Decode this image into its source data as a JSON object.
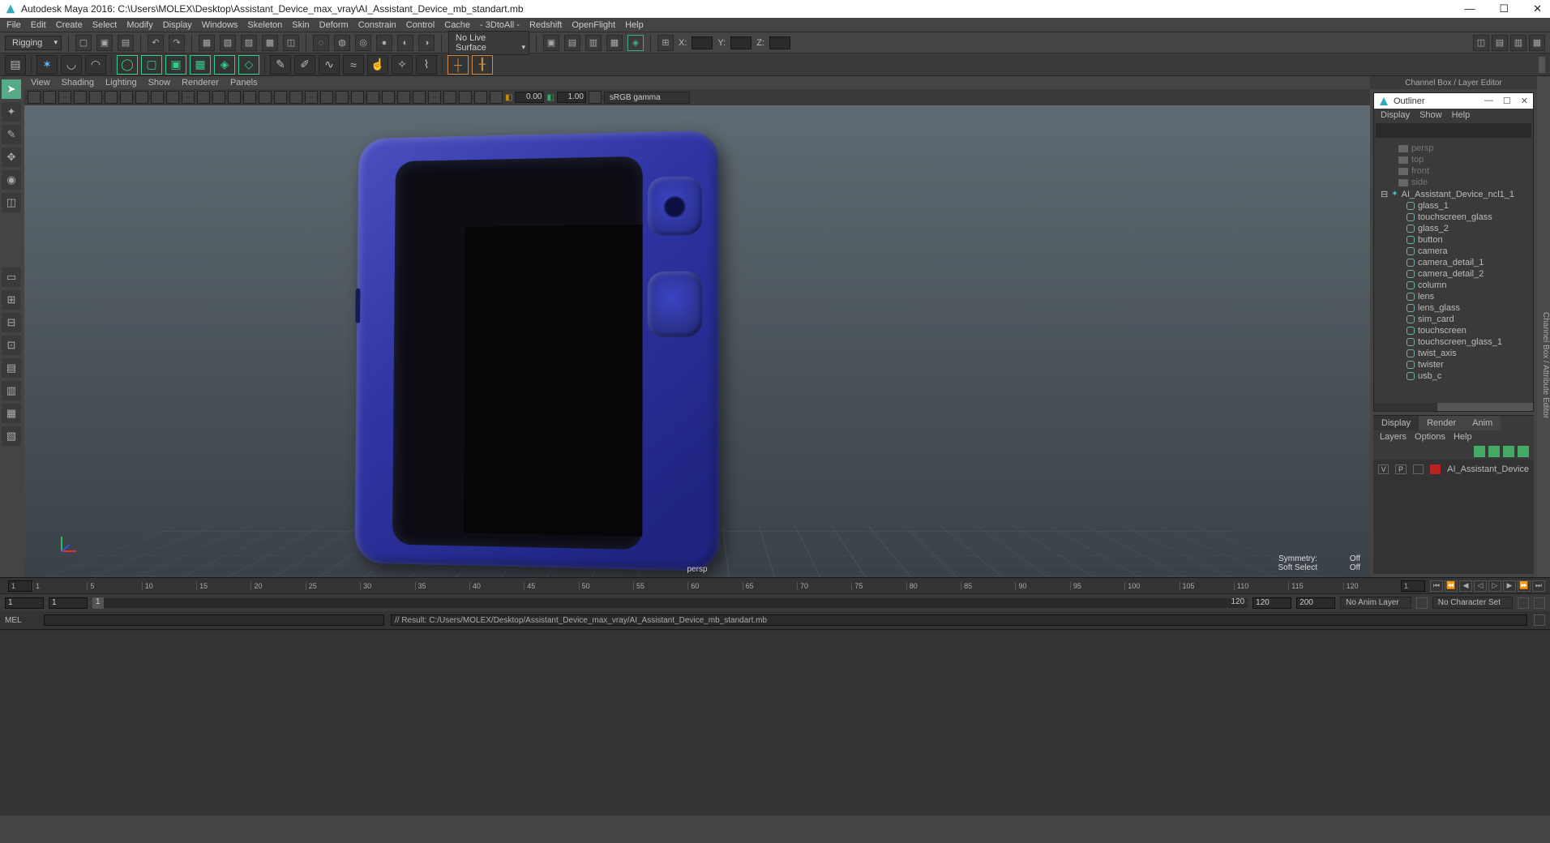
{
  "title": "Autodesk Maya 2016: C:\\Users\\MOLEX\\Desktop\\Assistant_Device_max_vray\\AI_Assistant_Device_mb_standart.mb",
  "menus": [
    "File",
    "Edit",
    "Create",
    "Select",
    "Modify",
    "Display",
    "Windows",
    "Skeleton",
    "Skin",
    "Deform",
    "Constrain",
    "Control",
    "Cache",
    "- 3DtoAll -",
    "Redshift",
    "OpenFlight",
    "Help"
  ],
  "mode": "Rigging",
  "live_surface": "No Live Surface",
  "coords": {
    "x": "X:",
    "y": "Y:",
    "z": "Z:"
  },
  "panel_menus": [
    "View",
    "Shading",
    "Lighting",
    "Show",
    "Renderer",
    "Panels"
  ],
  "gamma": "sRGB gamma",
  "exposure": "0.00",
  "gamma_val": "1.00",
  "camera": "persp",
  "symmetry": {
    "label": "Symmetry:",
    "value": "Off"
  },
  "softselect": {
    "label": "Soft Select",
    "value": "Off"
  },
  "channel": {
    "title": "Channel Box / Layer Editor"
  },
  "outliner": {
    "title": "Outliner",
    "menus": [
      "Display",
      "Show",
      "Help"
    ],
    "cameras": [
      "persp",
      "top",
      "front",
      "side"
    ],
    "root": "AI_Assistant_Device_ncl1_1",
    "children": [
      "glass_1",
      "touchscreen_glass",
      "glass_2",
      "button",
      "camera",
      "camera_detail_1",
      "camera_detail_2",
      "column",
      "lens",
      "lens_glass",
      "sim_card",
      "touchscreen",
      "touchscreen_glass_1",
      "twist_axis",
      "twister",
      "usb_c"
    ]
  },
  "layers": {
    "tabs": [
      "Display",
      "Render",
      "Anim"
    ],
    "sub": [
      "Layers",
      "Options",
      "Help"
    ],
    "vp": {
      "v": "V",
      "p": "P"
    },
    "layer_name": "AI_Assistant_Device"
  },
  "timeline": {
    "ticks": [
      "1",
      "5",
      "10",
      "15",
      "20",
      "25",
      "30",
      "35",
      "40",
      "45",
      "50",
      "55",
      "60",
      "65",
      "70",
      "75",
      "80",
      "85",
      "90",
      "95",
      "100",
      "105",
      "110",
      "115",
      "120"
    ],
    "current": "1"
  },
  "range": {
    "start1": "1",
    "start2": "1",
    "end1": "120",
    "end2": "120",
    "end3": "200",
    "anim_layer": "No Anim Layer",
    "char_set": "No Character Set"
  },
  "command": {
    "mel": "MEL",
    "result": "// Result: C:/Users/MOLEX/Desktop/Assistant_Device_max_vray/AI_Assistant_Device_mb_standart.mb"
  },
  "attr_side": "Channel Box / Attribute Editor"
}
